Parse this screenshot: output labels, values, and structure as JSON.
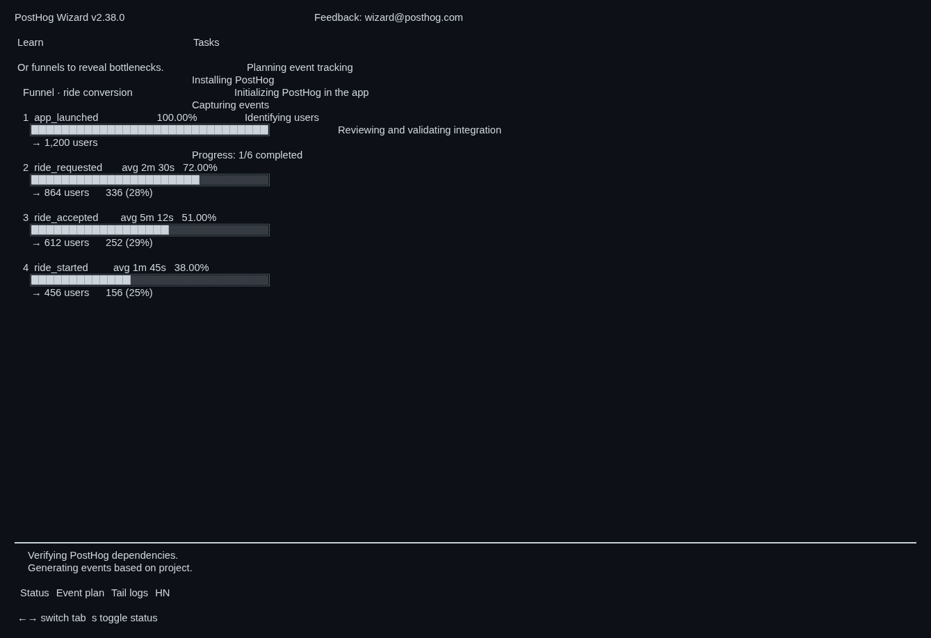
{
  "header": {
    "title": "PostHog Wizard v2.38.0",
    "feedback": "Feedback: wizard@posthog.com"
  },
  "learn": {
    "heading": "Learn",
    "text": "Or funnels to reveal bottlenecks.",
    "funnel": {
      "title": "Funnel · ride conversion",
      "steps": [
        {
          "number": "1",
          "event": "app_launched",
          "percent": "100.00%",
          "level": 1,
          "users": "→ 1,200 users"
        },
        {
          "number": "2",
          "event": "ride_requested",
          "avg": "avg 2m 30s",
          "percent": "72.00%",
          "level": 0.71,
          "users": "→ 864 users",
          "dropoff": "336 (28%)"
        },
        {
          "number": "3",
          "event": "ride_accepted",
          "avg": "avg 5m 12s",
          "percent": "51.00%",
          "level": 0.58,
          "users": "→ 612 users",
          "dropoff": "252 (29%)"
        },
        {
          "number": "4",
          "event": "ride_started",
          "avg": "avg 1m 45s",
          "percent": "38.00%",
          "level": 0.42,
          "users": "→ 456 users",
          "dropoff": "156 (25%)"
        }
      ]
    }
  },
  "tasks": {
    "heading": "Tasks",
    "items": [
      "Planning event tracking",
      "Installing PostHog",
      "Initializing PostHog in the app",
      "Capturing events",
      "Identifying users",
      "Reviewing and validating integration"
    ],
    "progress": "Progress: 1/6 completed"
  },
  "log": [
    "Verifying PostHog dependencies.",
    "Generating events based on project."
  ],
  "tabs": [
    {
      "label": "Status"
    },
    {
      "label": "Event plan"
    },
    {
      "label": "Tail logs"
    },
    {
      "label": "HN"
    }
  ],
  "hints": "←→ switch tab  s toggle status"
}
